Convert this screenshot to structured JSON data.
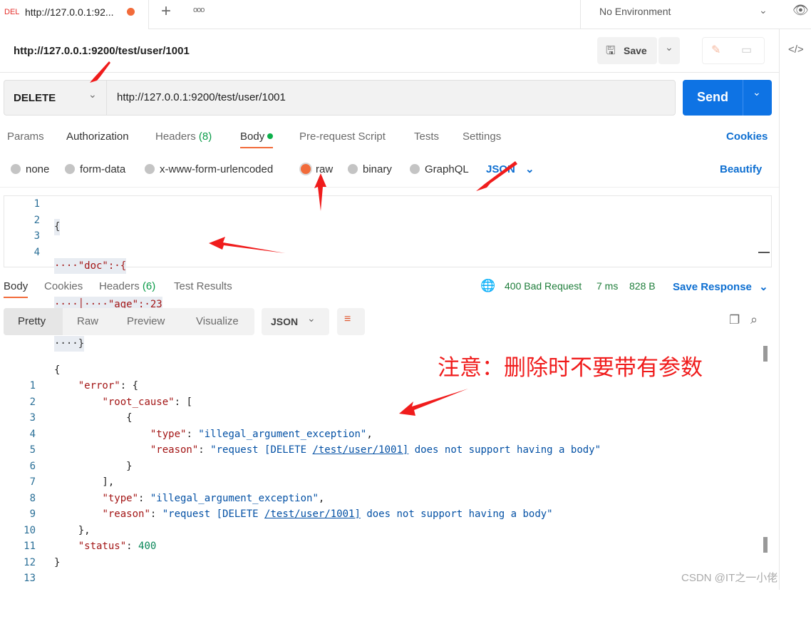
{
  "tab": {
    "method": "DEL",
    "title": "http://127.0.0.1:92..."
  },
  "env": {
    "label": "No Environment"
  },
  "request": {
    "title": "http://127.0.0.1:9200/test/user/1001",
    "save": "Save",
    "method": "DELETE",
    "url": "http://127.0.0.1:9200/test/user/1001",
    "send": "Send"
  },
  "req_tabs": {
    "params": "Params",
    "auth": "Authorization",
    "headers": "Headers",
    "headers_count": "(8)",
    "body": "Body",
    "prereq": "Pre-request Script",
    "tests": "Tests",
    "settings": "Settings",
    "cookies": "Cookies"
  },
  "body_types": {
    "none": "none",
    "form": "form-data",
    "urlenc": "x-www-form-urlencoded",
    "raw": "raw",
    "binary": "binary",
    "graphql": "GraphQL",
    "lang": "JSON",
    "beautify": "Beautify"
  },
  "req_body": [
    "{",
    "····\"doc\":·{",
    "····│····\"age\":·23",
    "····}"
  ],
  "resp_tabs": {
    "body": "Body",
    "cookies": "Cookies",
    "headers": "Headers",
    "headers_count": "(6)",
    "tests": "Test Results",
    "status": "400 Bad Request",
    "time": "7 ms",
    "size": "828 B",
    "save": "Save Response"
  },
  "view": {
    "pretty": "Pretty",
    "raw": "Raw",
    "preview": "Preview",
    "visualize": "Visualize",
    "lang": "JSON"
  },
  "annotation": "注意：删除时不要带有参数",
  "watermark": "CSDN @IT之一小佬",
  "resp_lines": [
    "1",
    "2",
    "3",
    "4",
    "5",
    "6",
    "7",
    "8",
    "9",
    "10",
    "11",
    "12",
    "13"
  ],
  "resp": {
    "error": "\"error\"",
    "root_cause": "\"root_cause\"",
    "type": "\"type\"",
    "type_val": "\"illegal_argument_exception\"",
    "reason": "\"reason\"",
    "reason_a": "\"request [DELETE ",
    "reason_link": "/test/user/1001]",
    "reason_b": " does not support having a body\"",
    "status": "\"status\"",
    "status_val": "400"
  }
}
